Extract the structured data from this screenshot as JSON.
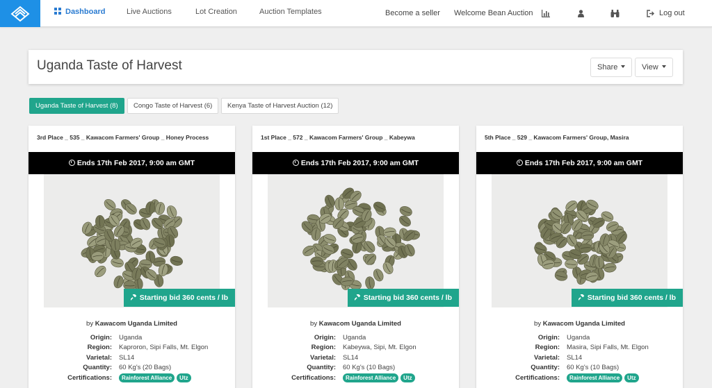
{
  "nav": {
    "links": [
      "Dashboard",
      "Live Auctions",
      "Lot Creation",
      "Auction Templates"
    ],
    "become_seller": "Become a seller",
    "welcome": "Welcome Bean Auction",
    "logout": "Log out"
  },
  "page": {
    "title": "Uganda Taste of Harvest",
    "share_label": "Share",
    "view_label": "View"
  },
  "tabs": [
    "Uganda Taste of Harvest (8)",
    "Congo Taste of Harvest (6)",
    "Kenya Taste of Harvest Auction (12)"
  ],
  "colors": {
    "accent": "#20a58c",
    "brand": "#1e90e6",
    "ends_bar": "#000000"
  },
  "cards": [
    {
      "title": "3rd Place _ 535 _ Kawacom Farmers' Group _ Honey Process",
      "ends": "Ends 17th Feb 2017, 9:00 am GMT",
      "bid": "Starting bid 360 cents / lb",
      "by_prefix": "by",
      "by": "Kawacom Uganda Limited",
      "labels": [
        "Origin:",
        "Region:",
        "Varietal:",
        "Quantity:",
        "Certifications:"
      ],
      "origin": "Uganda",
      "region": "Kaproron, Sipi Falls, Mt. Elgon",
      "varietal": "SL14",
      "quantity": "60 Kg's (20 Bags)",
      "certs": [
        "Rainforest Alliance",
        "Utz"
      ]
    },
    {
      "title": "1st Place _ 572 _ Kawacom Farmers' Group _ Kabeywa",
      "ends": "Ends 17th Feb 2017, 9:00 am GMT",
      "bid": "Starting bid 360 cents / lb",
      "by_prefix": "by",
      "by": "Kawacom Uganda Limited",
      "labels": [
        "Origin:",
        "Region:",
        "Varietal:",
        "Quantity:",
        "Certifications:"
      ],
      "origin": "Uganda",
      "region": "Kabeywa, Sipi, Mt. Elgon",
      "varietal": "SL14",
      "quantity": "60 Kg's (10 Bags)",
      "certs": [
        "Rainforest Alliance",
        "Utz"
      ]
    },
    {
      "title": "5th Place _ 529 _ Kawacom Farmers' Group, Masira",
      "ends": "Ends 17th Feb 2017, 9:00 am GMT",
      "bid": "Starting bid 360 cents / lb",
      "by_prefix": "by",
      "by": "Kawacom Uganda Limited",
      "labels": [
        "Origin:",
        "Region:",
        "Varietal:",
        "Quantity:",
        "Certifications:"
      ],
      "origin": "Uganda",
      "region": "Masira, Sipi Falls, Mt. Elgon",
      "varietal": "SL14",
      "quantity": "60 Kg's (10 Bags)",
      "certs": [
        "Rainforest Alliance",
        "Utz"
      ]
    }
  ]
}
